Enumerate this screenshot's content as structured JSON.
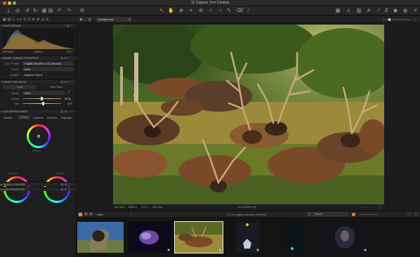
{
  "window": {
    "title": "11 Capture One Catalog"
  },
  "toolbar": {
    "left_icons": [
      "import-icon",
      "camera-icon",
      "rotate-left-icon",
      "rotate-right-icon",
      "trash-icon",
      "library-icon",
      "undo-icon",
      "redo-icon",
      "variant-icon"
    ],
    "center_icons": [
      "cursor-icon",
      "pan-icon",
      "zoom-icon",
      "crop-icon",
      "straighten-icon",
      "keystone-icon",
      "spot-icon",
      "brush-icon",
      "eraser-icon",
      "picker-icon"
    ],
    "right_icons": [
      "grid-icon",
      "warning-icon",
      "histogram-icon",
      "text-icon",
      "wand-icon",
      "copy-icon",
      "eye-icon",
      "globe-icon",
      "share-icon"
    ]
  },
  "subbar": {
    "layer_select": "Background"
  },
  "histogram": {
    "header": "HISTOGRAM",
    "iso": "ISO 800",
    "shutter": "1/500 s",
    "aperture": "f/7.1"
  },
  "base_characteristics": {
    "header": "BASE CHARACTERISTICS",
    "rows": [
      {
        "label": "ICC Profile",
        "value": "Fujifilm FinePix X-T1 Generic"
      },
      {
        "label": "Curve",
        "value": "Auto"
      },
      {
        "label": "Engine",
        "value": "Capture One 8"
      }
    ]
  },
  "white_balance": {
    "header": "WHITE BALANCE",
    "tabs": [
      "Lazy",
      "Skin Tone"
    ],
    "mode_label": "Mode",
    "mode_value": "Shot",
    "kelvin_label": "Kelvin",
    "kelvin_value": "5076",
    "tint_label": "Tint",
    "tint_value": "1.9"
  },
  "color_balance": {
    "header": "COLOR BALANCE",
    "tabs": [
      "Master",
      "3-Way",
      "Shadow",
      "Midtone",
      "Highlight"
    ],
    "active_tab": "3-Way",
    "wheel_labels": [
      "Shadow",
      "Midtone",
      "Highlight"
    ]
  },
  "black_white": {
    "header": "BLACK & WHITE"
  },
  "color_editor": {
    "header": "COLOR EDITOR"
  },
  "viewer": {
    "iso": "ISO 800",
    "shutter": "1/500 s",
    "aperture": "f/7.1",
    "focal": "200 mm",
    "filename": "JLC01096.RAF"
  },
  "browser": {
    "sort_label": "Date",
    "count_text": "1 of 6 Images selected (Filtered)",
    "search_placeholder": "Search",
    "thumbnails": 6
  },
  "colors": {
    "accent": "#e8893a",
    "panel": "#1e1e1e",
    "bg": "#141414"
  }
}
